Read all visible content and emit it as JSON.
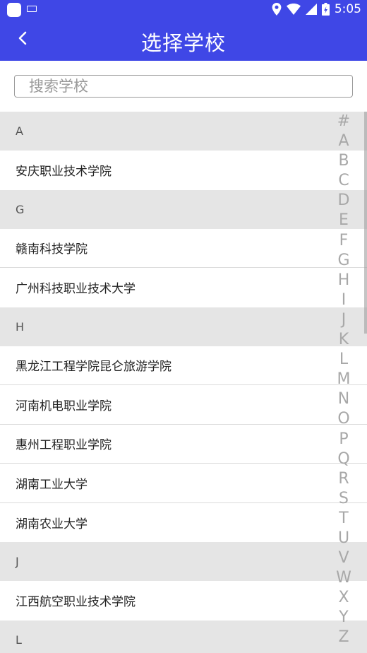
{
  "status_bar": {
    "time": "5:05",
    "icons": [
      "location-icon",
      "wifi-icon",
      "signal-icon",
      "battery-icon"
    ]
  },
  "app_bar": {
    "title": "选择学校",
    "background": "#3f47e6"
  },
  "search": {
    "placeholder": "搜索学校",
    "value": ""
  },
  "sections": [
    {
      "letter": "A",
      "schools": [
        "安庆职业技术学院"
      ]
    },
    {
      "letter": "G",
      "schools": [
        "赣南科技学院",
        "广州科技职业技术大学"
      ]
    },
    {
      "letter": "H",
      "schools": [
        "黑龙江工程学院昆仑旅游学院",
        "河南机电职业学院",
        "惠州工程职业学院",
        "湖南工业大学",
        "湖南农业大学"
      ]
    },
    {
      "letter": "J",
      "schools": [
        "江西航空职业技术学院"
      ]
    },
    {
      "letter": "L",
      "schools": []
    }
  ],
  "index_letters": [
    "#",
    "A",
    "B",
    "C",
    "D",
    "E",
    "F",
    "G",
    "H",
    "I",
    "J",
    "K",
    "L",
    "M",
    "N",
    "O",
    "P",
    "Q",
    "R",
    "S",
    "T",
    "U",
    "V",
    "W",
    "X",
    "Y",
    "Z"
  ]
}
